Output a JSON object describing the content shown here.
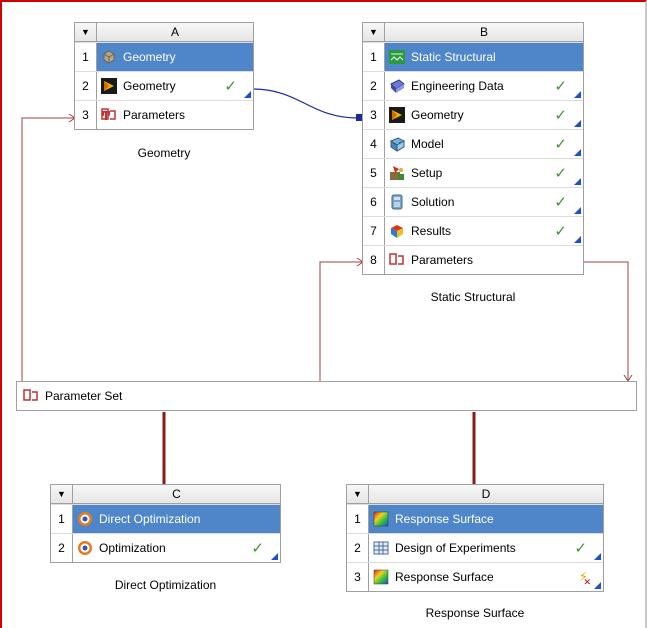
{
  "systems": [
    {
      "letter": "A",
      "caption": "Geometry",
      "rows": [
        {
          "num": "1",
          "label": "Geometry",
          "icon": "geometry-cube-icon",
          "status": "",
          "selected": true
        },
        {
          "num": "2",
          "label": "Geometry",
          "icon": "designmodeler-icon",
          "status": "up-to-date",
          "selected": false
        },
        {
          "num": "3",
          "label": "Parameters",
          "icon": "parameters-icon",
          "status": "",
          "selected": false
        }
      ]
    },
    {
      "letter": "B",
      "caption": "Static Structural",
      "rows": [
        {
          "num": "1",
          "label": "Static Structural",
          "icon": "static-structural-icon",
          "status": "",
          "selected": true
        },
        {
          "num": "2",
          "label": "Engineering Data",
          "icon": "engineering-data-icon",
          "status": "up-to-date",
          "selected": false
        },
        {
          "num": "3",
          "label": "Geometry",
          "icon": "designmodeler-icon",
          "status": "up-to-date",
          "selected": false
        },
        {
          "num": "4",
          "label": "Model",
          "icon": "model-icon",
          "status": "up-to-date",
          "selected": false
        },
        {
          "num": "5",
          "label": "Setup",
          "icon": "setup-icon",
          "status": "up-to-date",
          "selected": false
        },
        {
          "num": "6",
          "label": "Solution",
          "icon": "solution-icon",
          "status": "up-to-date",
          "selected": false
        },
        {
          "num": "7",
          "label": "Results",
          "icon": "results-icon",
          "status": "up-to-date",
          "selected": false
        },
        {
          "num": "8",
          "label": "Parameters",
          "icon": "parameters-icon",
          "status": "",
          "selected": false
        }
      ]
    },
    {
      "letter": "C",
      "caption": "Direct Optimization",
      "rows": [
        {
          "num": "1",
          "label": "Direct Optimization",
          "icon": "optimization-target-icon",
          "status": "",
          "selected": true
        },
        {
          "num": "2",
          "label": "Optimization",
          "icon": "optimization-target-icon",
          "status": "up-to-date",
          "selected": false
        }
      ]
    },
    {
      "letter": "D",
      "caption": "Response Surface",
      "rows": [
        {
          "num": "1",
          "label": "Response Surface",
          "icon": "response-surface-icon",
          "status": "",
          "selected": true
        },
        {
          "num": "2",
          "label": "Design of Experiments",
          "icon": "design-of-experiments-icon",
          "status": "up-to-date",
          "selected": false
        },
        {
          "num": "3",
          "label": "Response Surface",
          "icon": "response-surface-icon",
          "status": "update-required",
          "selected": false
        }
      ]
    }
  ],
  "parameter_set": {
    "label": "Parameter Set",
    "icon": "parameters-icon"
  },
  "colors": {
    "selected_row": "#4f85c9",
    "parameter_link": "#a04040",
    "data_link": "#1a2a9a",
    "optimization_link": "#8b1a1a",
    "check": "#3a9a2a"
  }
}
